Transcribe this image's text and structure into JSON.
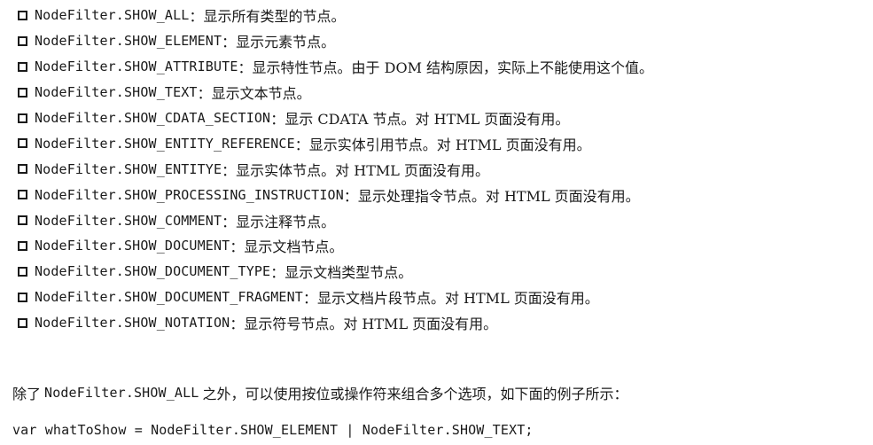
{
  "bullets": [
    {
      "code": "NodeFilter.SHOW_ALL",
      "desc": "：显示所有类型的节点。"
    },
    {
      "code": "NodeFilter.SHOW_ELEMENT",
      "desc": "：显示元素节点。"
    },
    {
      "code": "NodeFilter.SHOW_ATTRIBUTE",
      "desc": "：显示特性节点。由于 DOM 结构原因，实际上不能使用这个值。"
    },
    {
      "code": "NodeFilter.SHOW_TEXT",
      "desc": "：显示文本节点。"
    },
    {
      "code": "NodeFilter.SHOW_CDATA_SECTION",
      "desc": "：显示 CDATA 节点。对 HTML 页面没有用。"
    },
    {
      "code": "NodeFilter.SHOW_ENTITY_REFERENCE",
      "desc": "：显示实体引用节点。对 HTML 页面没有用。"
    },
    {
      "code": "NodeFilter.SHOW_ENTITYE",
      "desc": "：显示实体节点。对 HTML 页面没有用。"
    },
    {
      "code": "NodeFilter.SHOW_PROCESSING_INSTRUCTION",
      "desc": "：显示处理指令节点。对 HTML 页面没有用。"
    },
    {
      "code": "NodeFilter.SHOW_COMMENT",
      "desc": "：显示注释节点。"
    },
    {
      "code": "NodeFilter.SHOW_DOCUMENT",
      "desc": "：显示文档节点。"
    },
    {
      "code": "NodeFilter.SHOW_DOCUMENT_TYPE",
      "desc": "：显示文档类型节点。"
    },
    {
      "code": "NodeFilter.SHOW_DOCUMENT_FRAGMENT",
      "desc": "：显示文档片段节点。对 HTML 页面没有用。"
    },
    {
      "code": "NodeFilter.SHOW_NOTATION",
      "desc": "：显示符号节点。对 HTML 页面没有用。"
    }
  ],
  "paragraph": {
    "prefix": "除了",
    "code": "NodeFilter.SHOW_ALL",
    "suffix": "之外，可以使用按位或操作符来组合多个选项，如下面的例子所示："
  },
  "code_line": "var whatToShow = NodeFilter.SHOW_ELEMENT | NodeFilter.SHOW_TEXT;"
}
